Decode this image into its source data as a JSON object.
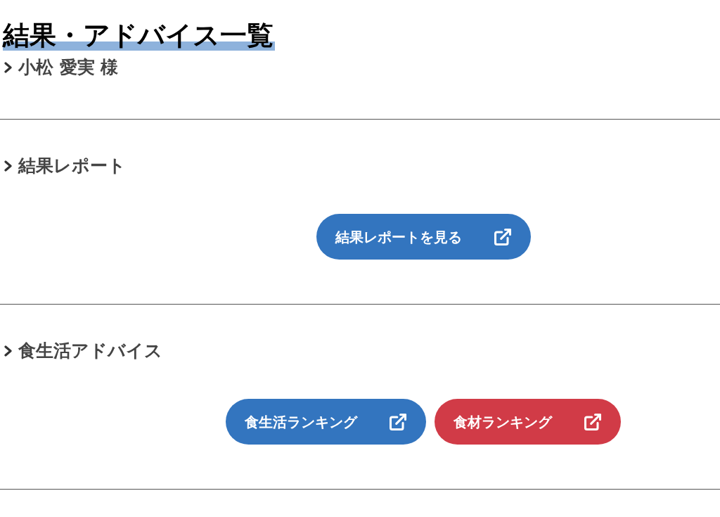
{
  "title": "結果・アドバイス一覧",
  "user_name": "小松 愛実 様",
  "sections": [
    {
      "heading": "結果レポート",
      "buttons": [
        {
          "label": "結果レポートを見る",
          "color": "#3375bf"
        }
      ]
    },
    {
      "heading": "食生活アドバイス",
      "buttons": [
        {
          "label": "食生活ランキング",
          "color": "#3375bf"
        },
        {
          "label": "食材ランキング",
          "color": "#d13b47"
        }
      ]
    }
  ]
}
